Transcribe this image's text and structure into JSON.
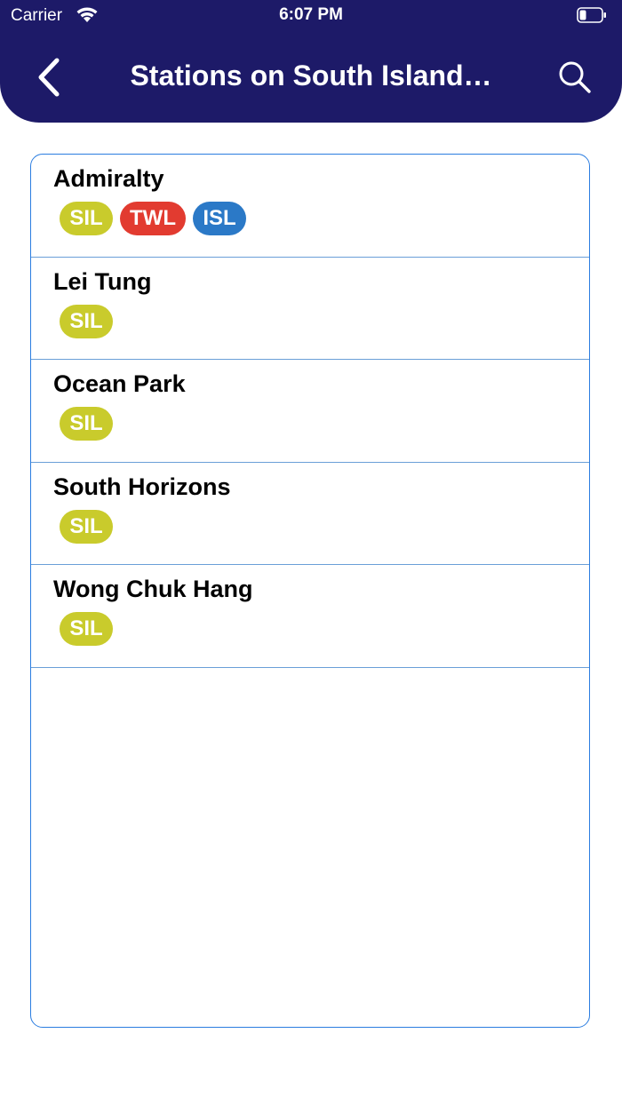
{
  "status_bar": {
    "carrier": "Carrier",
    "time": "6:07 PM",
    "wifi_icon": "wifi-icon",
    "battery_icon": "battery-icon"
  },
  "nav": {
    "title": "Stations on South Island…",
    "back_icon": "chevron-left-icon",
    "search_icon": "search-icon"
  },
  "colors": {
    "header_bg": "#1d1a68",
    "list_border": "#2b7de0",
    "SIL": "#c9cb2c",
    "TWL": "#e23b30",
    "ISL": "#2b79c7"
  },
  "stations": [
    {
      "name": "Admiralty",
      "lines": [
        "SIL",
        "TWL",
        "ISL"
      ]
    },
    {
      "name": "Lei Tung",
      "lines": [
        "SIL"
      ]
    },
    {
      "name": "Ocean Park",
      "lines": [
        "SIL"
      ]
    },
    {
      "name": "South Horizons",
      "lines": [
        "SIL"
      ]
    },
    {
      "name": "Wong Chuk Hang",
      "lines": [
        "SIL"
      ]
    }
  ]
}
